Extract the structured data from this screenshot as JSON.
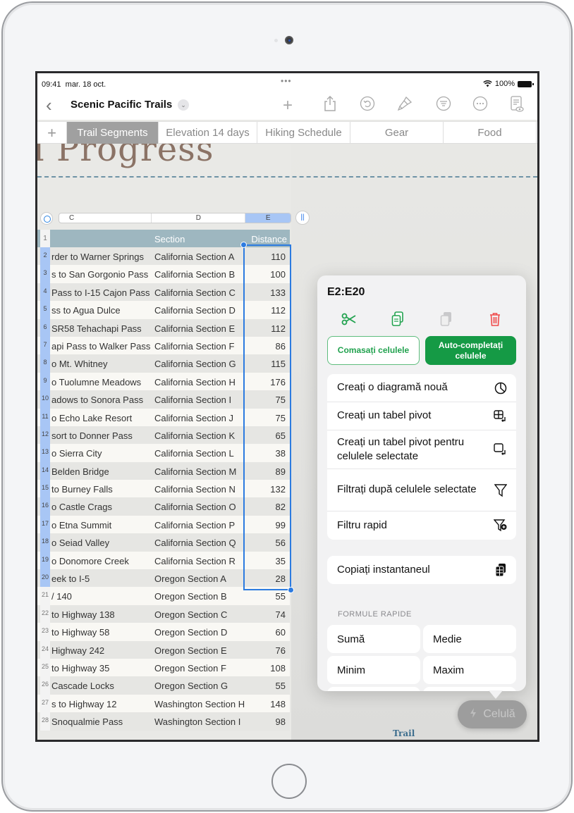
{
  "status_bar": {
    "time": "09:41",
    "date": "mar. 18 oct.",
    "battery": "100%"
  },
  "toolbar": {
    "document_title": "Scenic Pacific Trails",
    "icons": [
      "back-chevron",
      "title-dropdown",
      "add",
      "share",
      "undo",
      "format-brush",
      "organize",
      "more",
      "reader-view"
    ]
  },
  "sheet_tabs": {
    "add_label": "+",
    "tabs": [
      {
        "label": "Trail Segments",
        "active": true
      },
      {
        "label": "Elevation 14 days",
        "active": false
      },
      {
        "label": "Hiking Schedule",
        "active": false
      },
      {
        "label": "Gear",
        "active": false
      },
      {
        "label": "Food",
        "active": false
      }
    ]
  },
  "canvas": {
    "title_fragment": "il Progress",
    "footer_fragment": "Trail"
  },
  "column_headers": [
    "C",
    "D",
    "E"
  ],
  "selected_column": "E",
  "table": {
    "header_row_number": "1",
    "headers": {
      "c": "",
      "d": "Section",
      "e": "Distance"
    },
    "rows": [
      {
        "n": "2",
        "c": "rder to Warner Springs",
        "d": "California Section A",
        "e": "110"
      },
      {
        "n": "3",
        "c": "s to San Gorgonio Pass",
        "d": "California Section B",
        "e": "100"
      },
      {
        "n": "4",
        "c": "Pass to I-15 Cajon Pass",
        "d": "California Section C",
        "e": "133"
      },
      {
        "n": "5",
        "c": "ss to Agua Dulce",
        "d": "California Section D",
        "e": "112"
      },
      {
        "n": "6",
        "c": "SR58 Tehachapi Pass",
        "d": "California Section E",
        "e": "112"
      },
      {
        "n": "7",
        "c": "api Pass to Walker Pass",
        "d": "California Section F",
        "e": "86"
      },
      {
        "n": "8",
        "c": "o Mt. Whitney",
        "d": "California Section G",
        "e": "115"
      },
      {
        "n": "9",
        "c": "o Tuolumne Meadows",
        "d": "California Section H",
        "e": "176"
      },
      {
        "n": "10",
        "c": "adows to Sonora Pass",
        "d": "California Section I",
        "e": "75"
      },
      {
        "n": "11",
        "c": "o Echo Lake Resort",
        "d": "California Section J",
        "e": "75"
      },
      {
        "n": "12",
        "c": "sort to Donner Pass",
        "d": "California Section K",
        "e": "65"
      },
      {
        "n": "13",
        "c": "o Sierra City",
        "d": "California Section L",
        "e": "38"
      },
      {
        "n": "14",
        "c": "Belden Bridge",
        "d": "California Section M",
        "e": "89"
      },
      {
        "n": "15",
        "c": "to Burney Falls",
        "d": "California Section N",
        "e": "132"
      },
      {
        "n": "16",
        "c": "o Castle Crags",
        "d": "California Section O",
        "e": "82"
      },
      {
        "n": "17",
        "c": "o Etna Summit",
        "d": "California Section P",
        "e": "99"
      },
      {
        "n": "18",
        "c": "o Seiad Valley",
        "d": "California Section Q",
        "e": "56"
      },
      {
        "n": "19",
        "c": "o Donomore Creek",
        "d": "California Section R",
        "e": "35"
      },
      {
        "n": "20",
        "c": "eek to I-5",
        "d": "Oregon Section A",
        "e": "28"
      },
      {
        "n": "21",
        "c": "/ 140",
        "d": "Oregon Section B",
        "e": "55"
      },
      {
        "n": "22",
        "c": "to Highway 138",
        "d": "Oregon Section C",
        "e": "74"
      },
      {
        "n": "23",
        "c": "to Highway 58",
        "d": "Oregon Section D",
        "e": "60"
      },
      {
        "n": "24",
        "c": "Highway 242",
        "d": "Oregon Section E",
        "e": "76"
      },
      {
        "n": "25",
        "c": "to Highway 35",
        "d": "Oregon Section F",
        "e": "108"
      },
      {
        "n": "26",
        "c": "Cascade Locks",
        "d": "Oregon Section G",
        "e": "55"
      },
      {
        "n": "27",
        "c": "s to Highway 12",
        "d": "Washington Section H",
        "e": "148"
      },
      {
        "n": "28",
        "c": "Snoqualmie Pass",
        "d": "Washington Section I",
        "e": "98"
      }
    ]
  },
  "popover": {
    "range": "E2:E20",
    "icons": [
      "cut",
      "copy",
      "paste",
      "delete"
    ],
    "merge_label": "Comasați celulele",
    "autofill_label": "Auto-completați celulele",
    "group1": [
      {
        "label": "Creați o diagramă nouă",
        "icon": "chart-icon"
      },
      {
        "label": "Creați un tabel pivot",
        "icon": "pivot-table-icon"
      },
      {
        "label": "Creați un tabel pivot pentru celulele selectate",
        "icon": "pivot-selection-icon"
      },
      {
        "label": "Filtrați după celulele selectate",
        "icon": "filter-icon"
      },
      {
        "label": "Filtru rapid",
        "icon": "quick-filter-icon"
      }
    ],
    "group2": [
      {
        "label": "Copiați instantaneul",
        "icon": "snapshot-icon"
      }
    ],
    "quick_formulas_label": "FORMULE RAPIDE",
    "formulas": [
      "Sumă",
      "Medie",
      "Minim",
      "Maxim"
    ]
  },
  "cell_button": {
    "label": "Celulă",
    "icon": "lightning-icon"
  },
  "colors": {
    "accent_green": "#159a45",
    "selection_blue": "#2c7be0",
    "delete_red": "#f04a4a",
    "table_header": "#9eb7c0",
    "title_brown": "#8b7366"
  }
}
